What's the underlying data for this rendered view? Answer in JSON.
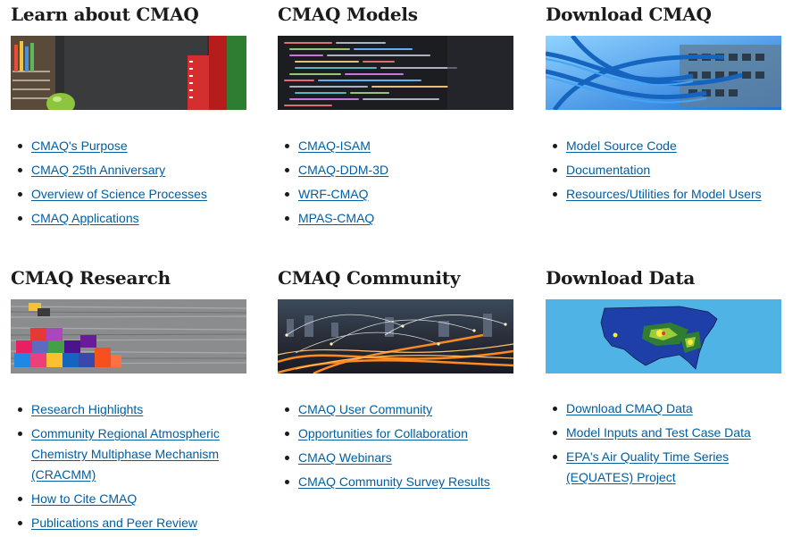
{
  "sections": [
    {
      "title": "Learn about CMAQ",
      "image": "classroom-chalkboard-apple-books",
      "links": [
        "CMAQ's Purpose",
        "CMAQ 25th Anniversary",
        "Overview of Science Processes",
        "CMAQ Applications"
      ]
    },
    {
      "title": "CMAQ Models",
      "image": "source-code-on-screen",
      "links": [
        "CMAQ-ISAM",
        "CMAQ-DDM-3D",
        "WRF-CMAQ",
        "MPAS-CMAQ"
      ]
    },
    {
      "title": "Download CMAQ",
      "image": "network-cables-server",
      "links": [
        "Model Source Code",
        "Documentation",
        "Resources/Utilities for Model Users"
      ]
    },
    {
      "title": "CMAQ Research",
      "image": "colorful-puzzle-blocks-on-wood",
      "links": [
        "Research Highlights",
        "Community Regional Atmospheric Chemistry Multiphase Mechanism (CRACMM)",
        "How to Cite CMAQ",
        "Publications and Peer Review"
      ]
    },
    {
      "title": "CMAQ Community",
      "image": "connected-city-night-lights",
      "links": [
        "CMAQ User Community",
        "Opportunities for Collaboration",
        "CMAQ Webinars",
        "CMAQ Community Survey Results"
      ]
    },
    {
      "title": "Download Data",
      "image": "us-air-quality-map",
      "links": [
        "Download CMAQ Data",
        "Model Inputs and Test Case Data",
        "EPA's Air Quality Time Series (EQUATES) Project"
      ]
    }
  ],
  "colors": {
    "link": "#005ea2",
    "heading": "#1b1b1b",
    "background": "#ffffff"
  }
}
